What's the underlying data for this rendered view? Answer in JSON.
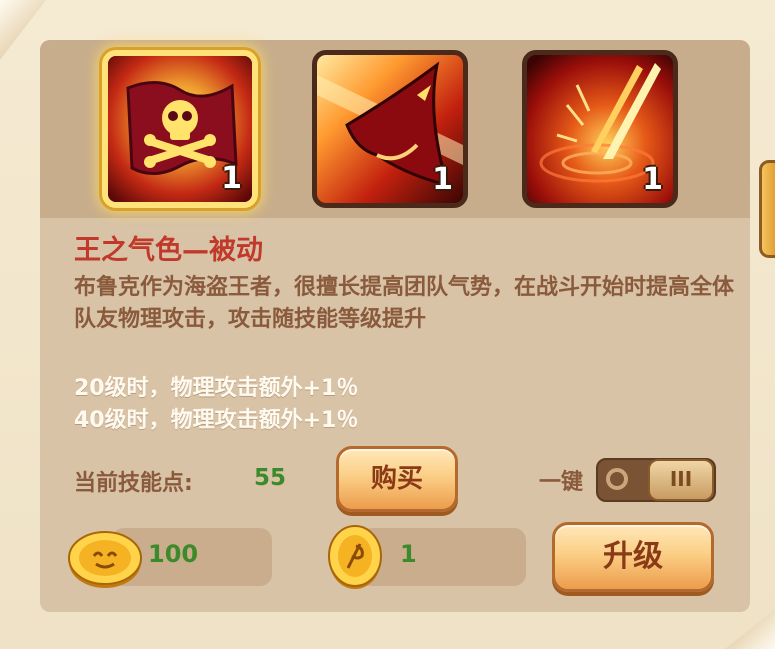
{
  "skills": [
    {
      "name": "pirate-flag",
      "level": "1",
      "selected": true
    },
    {
      "name": "shark-strike",
      "level": "1",
      "selected": false
    },
    {
      "name": "lightning-stab",
      "level": "1",
      "selected": false
    }
  ],
  "detail": {
    "title": "王之气色—被动",
    "description": "布鲁克作为海盗王者，很擅长提高团队气势，在战斗开始时提高全体队友物理攻击，攻击随技能等级提升",
    "bonus_lines": [
      "20级时，物理攻击额外+1％",
      "40级时，物理攻击额外+1％"
    ]
  },
  "skill_points": {
    "label": "当前技能点:",
    "value": "55"
  },
  "buttons": {
    "buy": "购买",
    "upgrade": "升级",
    "one_key": "一键"
  },
  "resources": {
    "gold": "100",
    "item": "1"
  },
  "colors": {
    "title": "#c0392b",
    "accent_green": "#3d8a2a",
    "text_brown": "#8a5a3c"
  }
}
